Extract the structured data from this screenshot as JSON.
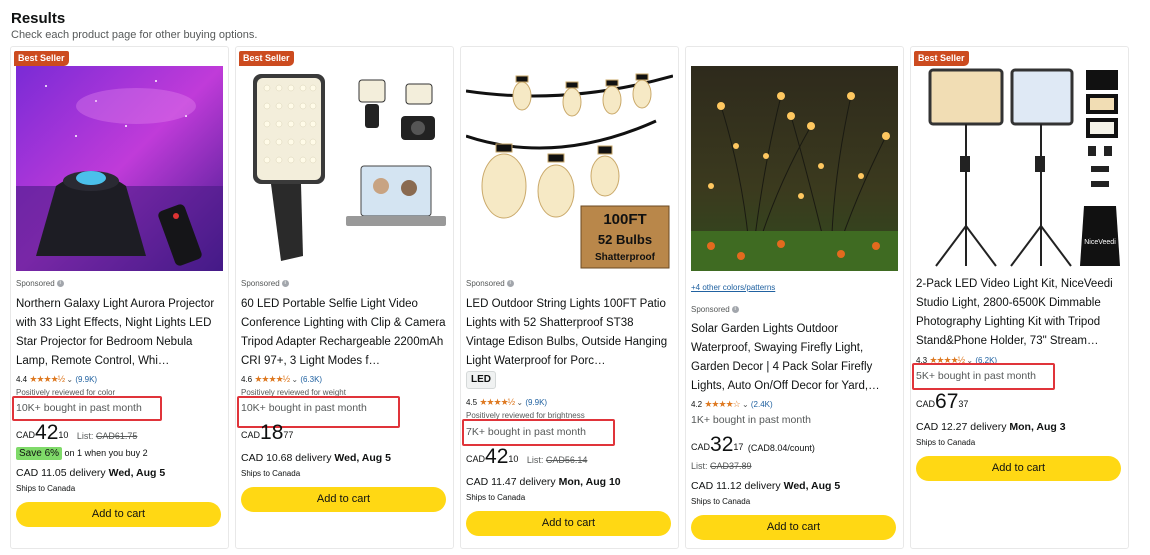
{
  "header": {
    "title": "Results",
    "subtitle": "Check each product page for other buying options."
  },
  "products": [
    {
      "badge": "Best Seller",
      "sponsored": "Sponsored",
      "title": "Northern Galaxy Light Aurora Projector with 33 Light Effects, Night Lights LED Star Projector for Bedroom Nebula Lamp, Remote Control, Whi…",
      "rating": "4.4",
      "stars": "★★★★½",
      "reviews": "(9.9K)",
      "positively": "Positively reviewed for color",
      "bought": "10K+ bought in past month",
      "currency": "CAD",
      "price_whole": "42",
      "price_frac": "10",
      "list_label": "List:",
      "list_price": "CAD61.75",
      "save_pill": "Save 6%",
      "save_text": "on 1 when you buy 2",
      "delivery_prefix": "CAD 11.05 delivery",
      "delivery_date": "Wed, Aug 5",
      "ships": "Ships to Canada",
      "cart": "Add to cart"
    },
    {
      "badge": "Best Seller",
      "sponsored": "Sponsored",
      "title": "60 LED Portable Selfie Light Video Conference Lighting with Clip & Camera Tripod Adapter Rechargeable 2200mAh CRI 97+, 3 Light Modes f…",
      "rating": "4.6",
      "stars": "★★★★½",
      "reviews": "(6.3K)",
      "positively": "Positively reviewed for weight",
      "bought": "10K+ bought in past month",
      "currency": "CAD",
      "price_whole": "18",
      "price_frac": "77",
      "delivery_prefix": "CAD 10.68 delivery",
      "delivery_date": "Wed, Aug 5",
      "ships": "Ships to Canada",
      "cart": "Add to cart"
    },
    {
      "sponsored": "Sponsored",
      "title": "LED Outdoor String Lights 100FT Patio Lights with 52 Shatterproof ST38 Vintage Edison Bulbs, Outside Hanging Light Waterproof for Porc…",
      "chip": "LED",
      "rating": "4.5",
      "stars": "★★★★½",
      "reviews": "(9.9K)",
      "positively": "Positively reviewed for brightness",
      "bought": "7K+ bought in past month",
      "currency": "CAD",
      "price_whole": "42",
      "price_frac": "10",
      "list_label": "List:",
      "list_price": "CAD56.14",
      "delivery_prefix": "CAD 11.47 delivery",
      "delivery_date": "Mon, Aug 10",
      "ships": "Ships to Canada",
      "cart": "Add to cart",
      "box_text_1": "100FT",
      "box_text_2": "52 Bulbs",
      "box_text_3": "Shatterproof"
    },
    {
      "colors_link": "+4 other colors/patterns",
      "sponsored": "Sponsored",
      "title": "Solar Garden Lights Outdoor Waterproof, Swaying Firefly Light, Garden Decor | 4 Pack Solar Firefly Lights, Auto On/Off Decor for Yard,…",
      "rating": "4.2",
      "stars": "★★★★☆",
      "reviews": "(2.4K)",
      "bought": "1K+ bought in past month",
      "currency": "CAD",
      "price_whole": "32",
      "price_frac": "17",
      "unit_price": "(CAD8.04/count)",
      "list_label": "List:",
      "list_price": "CAD37.89",
      "delivery_prefix": "CAD 11.12 delivery",
      "delivery_date": "Wed, Aug 5",
      "ships": "Ships to Canada",
      "cart": "Add to cart"
    },
    {
      "badge": "Best Seller",
      "title": "2-Pack LED Video Light Kit, NiceVeedi Studio Light, 2800-6500K Dimmable Photography Lighting Kit with Tripod Stand&Phone Holder, 73\" Stream…",
      "rating": "4.3",
      "stars": "★★★★½",
      "reviews": "(6.2K)",
      "bought": "5K+ bought in past month",
      "currency": "CAD",
      "price_whole": "67",
      "price_frac": "37",
      "delivery_prefix": "CAD 12.27 delivery",
      "delivery_date": "Mon, Aug 3",
      "ships": "Ships to Canada",
      "cart": "Add to cart",
      "bag_logo": "NiceVeedi"
    }
  ],
  "colors": {
    "badge": "#CC4B1F",
    "cart": "#FFD814",
    "highlight": "#e0343a",
    "link": "#2162A1",
    "star": "#DE7921"
  }
}
